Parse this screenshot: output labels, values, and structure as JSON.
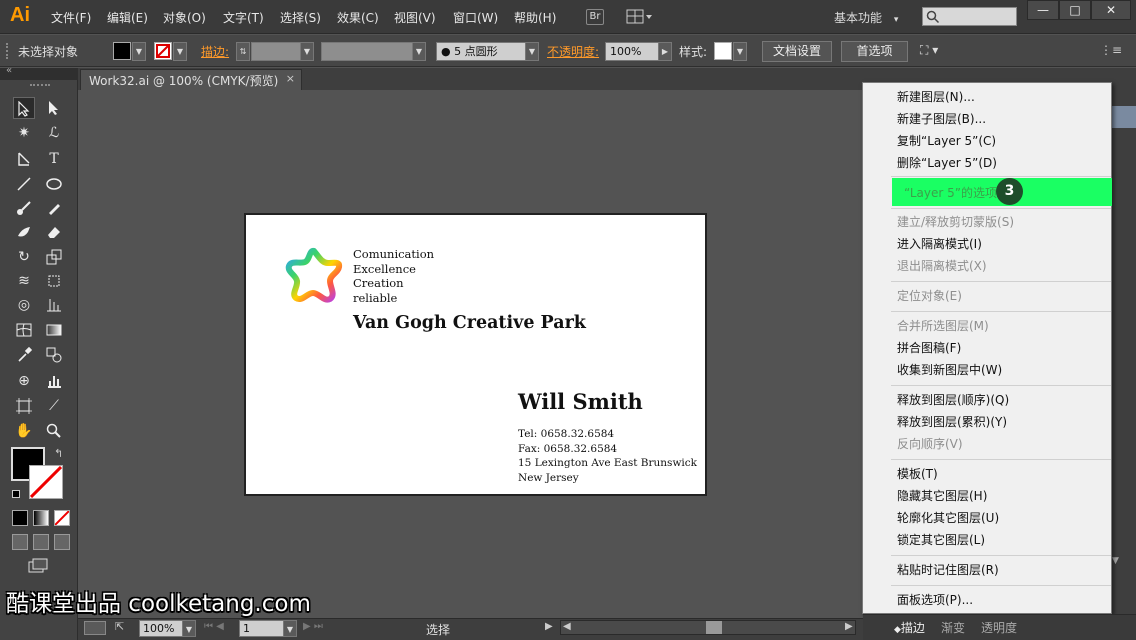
{
  "app": {
    "logo": "Ai",
    "accent": "#ff9a00"
  },
  "menubar": {
    "items": [
      "文件(F)",
      "编辑(E)",
      "对象(O)",
      "文字(T)",
      "选择(S)",
      "效果(C)",
      "视图(V)",
      "窗口(W)",
      "帮助(H)"
    ],
    "bridge_label": "Br",
    "workspace": "基本功能",
    "window_buttons": [
      "—",
      "□",
      "✕"
    ]
  },
  "controlbar": {
    "selection_status": "未选择对象",
    "stroke_label": "描边:",
    "brush_label": "5 点圆形",
    "opacity_label": "不透明度:",
    "opacity_value": "100%",
    "style_label": "样式:",
    "doc_settings_button": "文档设置",
    "preferences_button": "首选项"
  },
  "document_tab": {
    "title": "Work32.ai @ 100% (CMYK/预览)",
    "close": "×"
  },
  "card": {
    "tags": [
      "Comunication",
      "Excellence",
      "Creation",
      "reliable"
    ],
    "company": "Van Gogh Creative Park",
    "name": "Will Smith",
    "contact": [
      "Tel: 0658.32.6584",
      "Fax: 0658.32.6584",
      "15 Lexington Ave East Brunswick",
      "New Jersey"
    ]
  },
  "context_menu": {
    "items": [
      {
        "label": "新建图层(N)...",
        "disabled": false
      },
      {
        "label": "新建子图层(B)...",
        "disabled": false
      },
      {
        "label": "复制“Layer 5”(C)",
        "disabled": false
      },
      {
        "label": "删除“Layer 5”(D)",
        "disabled": false
      },
      {
        "label": "建立/释放剪切蒙版(S)",
        "disabled": true
      },
      {
        "label": "进入隔离模式(I)",
        "disabled": false
      },
      {
        "label": "退出隔离模式(X)",
        "disabled": true
      },
      {
        "label": "定位对象(E)",
        "disabled": true
      },
      {
        "label": "合并所选图层(M)",
        "disabled": true
      },
      {
        "label": "拼合图稿(F)",
        "disabled": false
      },
      {
        "label": "收集到新图层中(W)",
        "disabled": false
      },
      {
        "label": "释放到图层(顺序)(Q)",
        "disabled": false
      },
      {
        "label": "释放到图层(累积)(Y)",
        "disabled": false
      },
      {
        "label": "反向顺序(V)",
        "disabled": true
      },
      {
        "label": "模板(T)",
        "disabled": false
      },
      {
        "label": "隐藏其它图层(H)",
        "disabled": false
      },
      {
        "label": "轮廓化其它图层(U)",
        "disabled": false
      },
      {
        "label": "锁定其它图层(L)",
        "disabled": false
      },
      {
        "label": "粘贴时记住图层(R)",
        "disabled": false
      },
      {
        "label": "面板选项(P)...",
        "disabled": false
      }
    ],
    "highlighted_label": "“Layer 5”的选项...",
    "highlight_color": "#1aff63",
    "step_badge": "3"
  },
  "statusbar": {
    "zoom": "100%",
    "artboard_number": "1",
    "tool_label": "选择"
  },
  "bottom_tabs": [
    "描边",
    "渐变",
    "透明度"
  ],
  "watermark": "酷课堂出品 coolketang.com"
}
